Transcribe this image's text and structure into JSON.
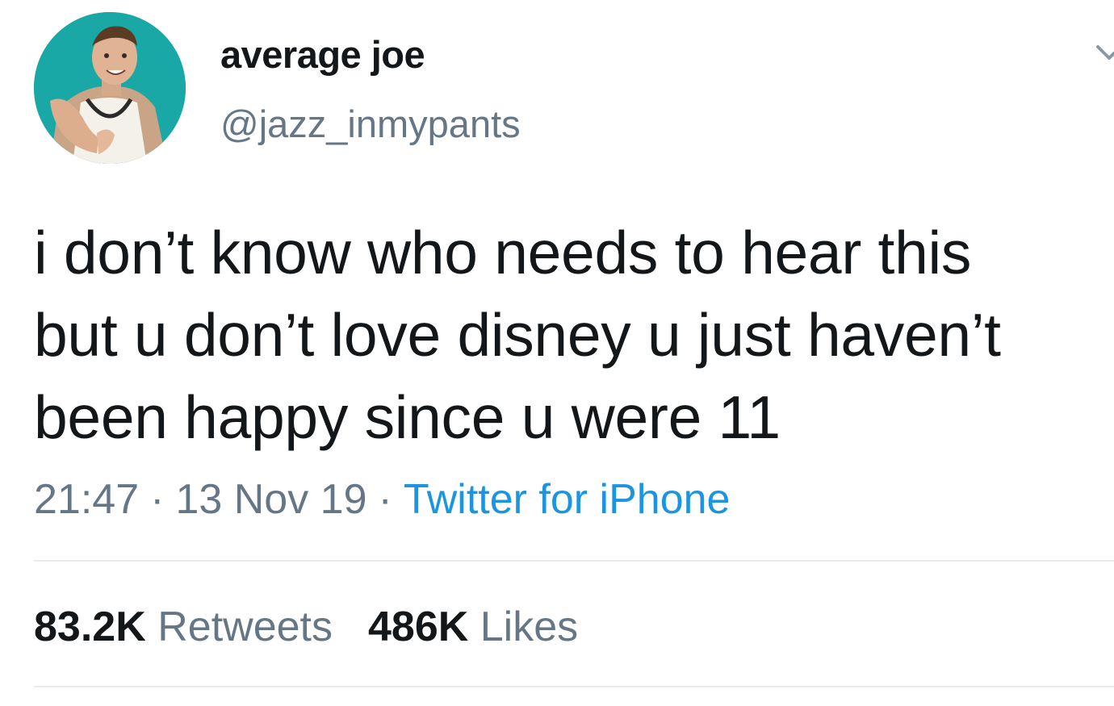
{
  "author": {
    "display_name": "average joe",
    "handle": "@jazz_inmypants"
  },
  "tweet": {
    "lines": [
      "i don’t know who needs to hear this",
      "but u don’t love disney u just haven’t",
      "been happy since u were 11"
    ],
    "time": "21:47",
    "date": "13 Nov 19",
    "separator": "·",
    "source": "Twitter for iPhone"
  },
  "stats": {
    "retweets_count": "83.2K",
    "retweets_label": "Retweets",
    "likes_count": "486K",
    "likes_label": "Likes"
  },
  "icons": {
    "menu": "chevron-down-icon",
    "avatar": "profile-photo"
  },
  "colors": {
    "text_primary": "#14171a",
    "text_secondary": "#657786",
    "link": "#1b95e0",
    "divider": "#e6ecf0",
    "avatar_bg": "#1aa8a6"
  }
}
